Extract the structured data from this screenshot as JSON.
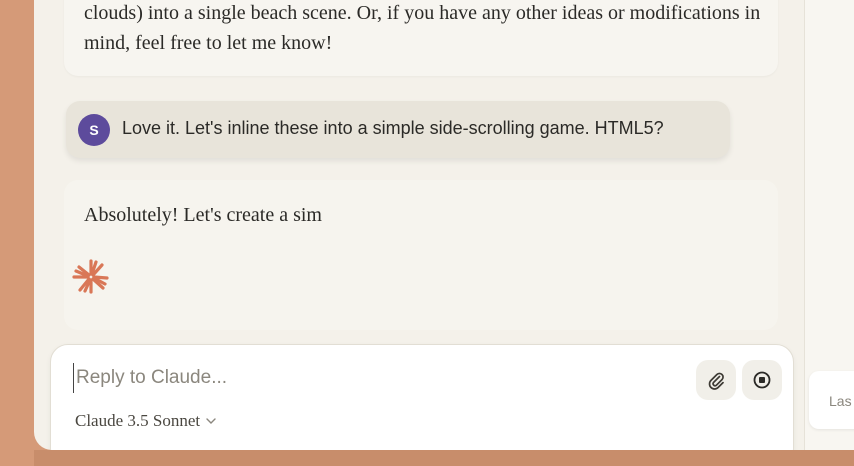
{
  "messages": {
    "assistant_previous": "clouds) into a single beach scene. Or, if you have any other ideas or modifications in mind, feel free to let me know!",
    "user": {
      "avatar_initial": "S",
      "text": "Love it. Let's inline these into a simple side-scrolling game. HTML5?"
    },
    "assistant_streaming": "Absolutely! Let's create a sim"
  },
  "composer": {
    "placeholder": "Reply to Claude...",
    "value": "",
    "model_label": "Claude 3.5 Sonnet",
    "attach_icon": "paperclip-icon",
    "stop_icon": "stop-icon"
  },
  "side_panel": {
    "card_text": "Las"
  },
  "colors": {
    "background": "#d59a78",
    "avatar": "#5d4b9c",
    "claude_accent": "#d97757"
  }
}
